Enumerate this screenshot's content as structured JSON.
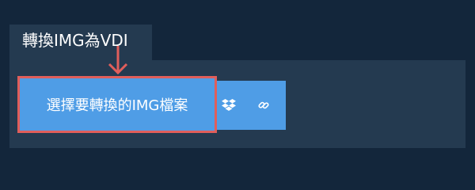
{
  "tab": {
    "title": "轉換IMG為VDI"
  },
  "upload": {
    "choose_label": "選擇要轉換的IMG檔案",
    "dropbox_icon": "dropbox-icon",
    "link_icon": "link-icon"
  },
  "colors": {
    "background": "#13263b",
    "panel": "#243a50",
    "button": "#4f9de6",
    "highlight": "#e05e5b",
    "text": "#ffffff"
  }
}
